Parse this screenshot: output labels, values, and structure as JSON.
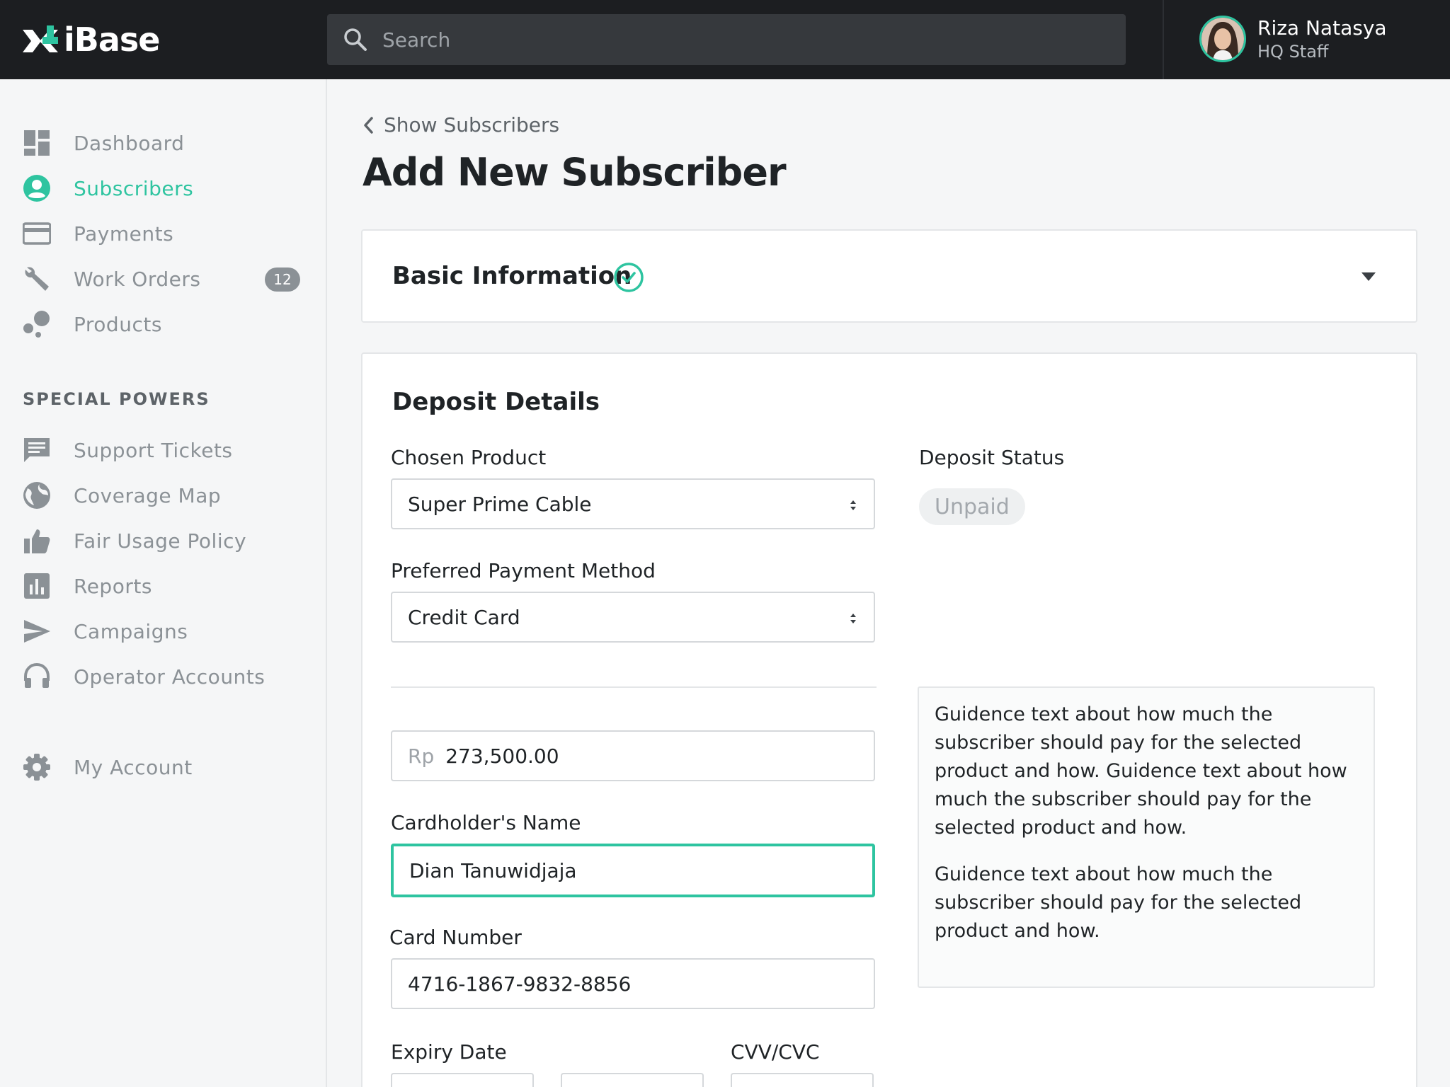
{
  "app": {
    "logo_text": "iBase"
  },
  "search": {
    "placeholder": "Search"
  },
  "user": {
    "name": "Riza Natasya",
    "role": "HQ Staff"
  },
  "sidebar": {
    "items": [
      {
        "label": "Dashboard",
        "icon": "dashboard-icon"
      },
      {
        "label": "Subscribers",
        "icon": "user-circle-icon",
        "active": true
      },
      {
        "label": "Payments",
        "icon": "credit-card-icon"
      },
      {
        "label": "Work Orders",
        "icon": "wrench-icon",
        "badge": "12"
      },
      {
        "label": "Products",
        "icon": "bubbles-icon"
      }
    ],
    "section_title": "SPECIAL POWERS",
    "special_items": [
      {
        "label": "Support Tickets",
        "icon": "chat-icon"
      },
      {
        "label": "Coverage Map",
        "icon": "globe-icon"
      },
      {
        "label": "Fair Usage Policy",
        "icon": "thumbs-up-icon"
      },
      {
        "label": "Reports",
        "icon": "bar-chart-icon"
      },
      {
        "label": "Campaigns",
        "icon": "paper-plane-icon"
      },
      {
        "label": "Operator Accounts",
        "icon": "headset-icon"
      }
    ],
    "account": {
      "label": "My Account",
      "icon": "gear-icon"
    }
  },
  "main": {
    "back_label": "Show Subscribers",
    "page_title": "Add New Subscriber",
    "basic_info": {
      "title": "Basic Information",
      "completed": true
    },
    "deposit": {
      "title": "Deposit Details",
      "chosen_product": {
        "label": "Chosen Product",
        "value": "Super Prime Cable"
      },
      "payment_method": {
        "label": "Preferred Payment Method",
        "value": "Credit Card"
      },
      "deposit_status": {
        "label": "Deposit Status",
        "value": "Unpaid"
      },
      "amount": {
        "prefix": "Rp",
        "value": "273,500.00"
      },
      "cardholder": {
        "label": "Cardholder's Name",
        "value": "Dian Tanuwidjaja"
      },
      "card_number": {
        "label": "Card Number",
        "value": "4716-1867-9832-8856"
      },
      "expiry": {
        "label": "Expiry Date"
      },
      "cvv": {
        "label": "CVV/CVC"
      },
      "guidance": [
        "Guidence text about how much the subscriber should pay for the selected product and how. Guidence text about how much the subscriber should pay for the selected product and how.",
        "Guidence text about how much the subscriber should pay for the selected product and how."
      ]
    }
  },
  "colors": {
    "accent": "#2ec4a0",
    "topbar": "#1c1e21",
    "muted": "#8b9196"
  }
}
